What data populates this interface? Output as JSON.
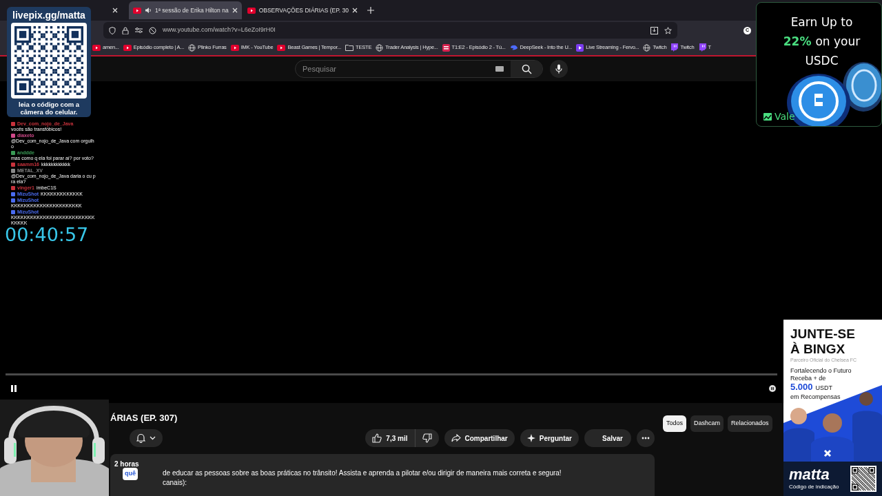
{
  "tabs": [
    {
      "selected": false
    },
    {
      "title": "1ª sessão de Erika Hilton na",
      "selected": true,
      "audio": true
    },
    {
      "title": "OBSERVAÇÕES DIÁRIAS (EP. 30",
      "selected": false
    }
  ],
  "address": "www.youtube.com/watch?v=L6eZoI9rH0I",
  "profile_initial": "C",
  "bookmarks": [
    {
      "label": "amen...",
      "kind": "youtube"
    },
    {
      "label": "Episódio completo | A...",
      "kind": "youtube"
    },
    {
      "label": "Plinko Furras",
      "kind": "globe"
    },
    {
      "label": "IMK - YouTube",
      "kind": "youtube"
    },
    {
      "label": "Beast Games | Tempor...",
      "kind": "youtube"
    },
    {
      "label": "TESTE",
      "kind": "folder"
    },
    {
      "label": "Trader Analysis | Hype...",
      "kind": "globe"
    },
    {
      "label": "T1:E2 - Episódio 2 - Tú...",
      "kind": "app"
    },
    {
      "label": "DeepSeek - Into the U...",
      "kind": "whale"
    },
    {
      "label": "Live Streaming - Fervo...",
      "kind": "play"
    },
    {
      "label": "Twitch",
      "kind": "globe"
    },
    {
      "label": "Twitch",
      "kind": "twitch"
    },
    {
      "label": "T",
      "kind": "twitch"
    }
  ],
  "search_placeholder": "Pesquisar",
  "video_title": "ÁRIAS (EP. 307)",
  "actions": [
    {
      "kind": "like",
      "label": "7,3 mil"
    },
    {
      "kind": "dislike"
    },
    {
      "kind": "share",
      "label": "Compartilhar"
    },
    {
      "kind": "ask",
      "label": "Perguntar"
    },
    {
      "kind": "save",
      "label": "Salvar"
    },
    {
      "kind": "more"
    }
  ],
  "chips": [
    {
      "label": "Todos",
      "selected": true
    },
    {
      "label": "Dashcam",
      "selected": false
    },
    {
      "label": "Relacionados",
      "selected": false
    }
  ],
  "description": {
    "age": "2 horas",
    "tooltip": "quê",
    "lines": [
      "de educar as pessoas sobre as boas práticas no trânsito! Assista e aprenda a pilotar e/ou dirigir de maneira mais correta e segura!",
      "canais):"
    ]
  },
  "qr_panel": {
    "url": "livepix.gg/matta",
    "caption": "leia o código com a câmera do celular."
  },
  "chat": [
    {
      "user": "Dev_com_nojo_de_Java",
      "color": "#c8323c",
      "text": "vocês são transfóbicos!"
    },
    {
      "user": "diaxeto",
      "color": "#d04a8a",
      "text": "@Dev_com_nojo_de_Java com orgulho"
    },
    {
      "user": "anddde",
      "color": "#3a9a55",
      "text": "mas como q ela foi parar aí? por voto?"
    },
    {
      "user": "saamm16",
      "color": "#c8323c",
      "text": "kkkkkkkkkkkk"
    },
    {
      "user": "METAL_XV",
      "color": "#8a8a8a",
      "text": "@Dev_com_nojo_de_Java daria o cu pra ela?"
    },
    {
      "user": "vinger1",
      "color": "#c8323c",
      "text": "imbeC1S"
    },
    {
      "user": "MizuShot",
      "color": "#4a6cf0",
      "text": "KKKKKKKKKKKKK"
    },
    {
      "user": "MizuShot",
      "color": "#4a6cf0",
      "text": "KKKKKKKKKKKKKKKKKKKKKK"
    },
    {
      "user": "MizuShot",
      "color": "#4a6cf0",
      "text": "KKKKKKKKKKKKKKKKKKKKKKKKKKKKKKK"
    }
  ],
  "timer": "00:40:57",
  "ad_top": {
    "line_1": "Earn Up to",
    "highlight": "22%",
    "line_2": "on your",
    "line_3": "USDC",
    "brand": "Vale"
  },
  "ad_bottom": {
    "headline_1": "JUNTE-SE",
    "headline_2": "À BINGX",
    "partner": "Parceiro Oficial do Chelsea FC",
    "line_1": "Fortalecendo o Futuro",
    "line_2": "Receba + de",
    "amount": "5.000",
    "currency": "USDT",
    "line_3": "em Recompensas",
    "brand": "matta",
    "code_label": "Código de indicação"
  }
}
